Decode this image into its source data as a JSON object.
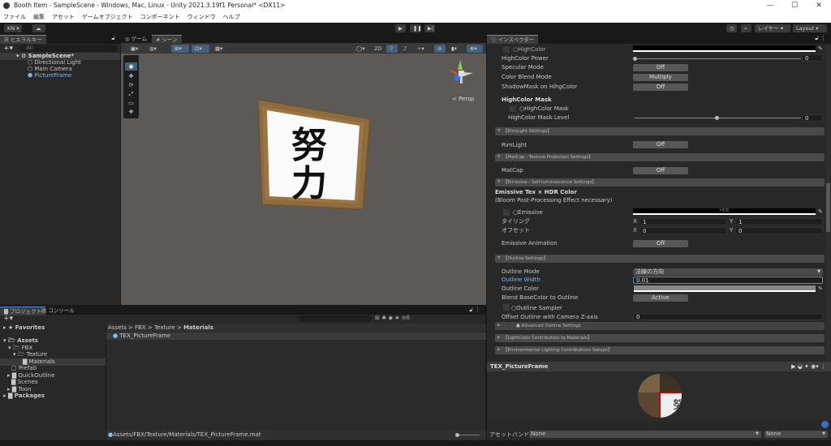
{
  "window": {
    "title": "Booth Item - SampleScene - Windows, Mac, Linux - Unity 2021.3.19f1 Personal* <DX11>",
    "minimize": "—",
    "maximize": "☐",
    "close": "✕"
  },
  "menu": [
    "ファイル",
    "編集",
    "アセット",
    "ゲームオブジェクト",
    "コンポーネント",
    "ウィンドウ",
    "ヘルプ"
  ],
  "toolbar": {
    "account": "KN ▾",
    "layers": "レイヤー",
    "layout": "Layout"
  },
  "hierarchy": {
    "tab": "ヒエラルキー",
    "search_placeholder": "All",
    "scene": "SampleScene*",
    "items": [
      "Directional Light",
      "Main Camera",
      "PictureFrame"
    ]
  },
  "scene_view": {
    "tabs": [
      "ゲーム",
      "シーン"
    ],
    "mode_2d": "2D",
    "persp": "Persp",
    "artwork_text": [
      "努",
      "力"
    ]
  },
  "inspector": {
    "tab": "インスペクター",
    "highcolor": "HighColor",
    "highcolor_power": {
      "label": "HighColor Power",
      "value": "0"
    },
    "specular_mode": {
      "label": "Specular Mode",
      "value": "Off"
    },
    "color_blend_mode": {
      "label": "Color Blend Mode",
      "value": "Multiply"
    },
    "shadowmask": {
      "label": "ShadowMask on HihgColor",
      "value": "Off"
    },
    "highcolor_mask_heading": "HighColor Mask",
    "highcolor_mask": "HighColor Mask",
    "highcolor_mask_level": {
      "label": "HighColor Mask Level",
      "value": "0"
    },
    "rimlight_header": "【RimLight Settings】",
    "rimlight": {
      "label": "RimLight",
      "value": "Off"
    },
    "matcap_header": "【MatCap : Texture Projection Settings】",
    "matcap": {
      "label": "MatCap",
      "value": "Off"
    },
    "emissive_header": "【Emissive : Self-luminescence Settings】",
    "emissive_title": "Emissive Tex × HDR Color",
    "emissive_note": "(Bloom Post-Processing Effect necessary)",
    "emissive": {
      "label": "Emissive",
      "hdr": "HDR"
    },
    "tiling": {
      "label": "タイリング",
      "x": "1",
      "y": "1"
    },
    "offset": {
      "label": "オフセット",
      "x": "0",
      "y": "0"
    },
    "axis_x": "X",
    "axis_y": "Y",
    "emissive_animation": {
      "label": "Emissive Animation",
      "value": "Off"
    },
    "outline_header": "【Outline Settings】",
    "outline_mode": {
      "label": "Outline Mode",
      "value": "法線の方向"
    },
    "outline_width": {
      "label": "Outline Width",
      "value": "0.01"
    },
    "outline_color": {
      "label": "Outline Color"
    },
    "blend_basecolor": {
      "label": "Blend BaseColor to Outline",
      "value": "Active"
    },
    "outline_sampler": "Outline Sampler",
    "offset_z": {
      "label": "Offset Outline with Camera Z-axis",
      "value": "0"
    },
    "advanced_outline": "● Advanced Outline Settings",
    "lightcolor_header": "【LightColor Contribution to Materials】",
    "environmental_header": "【Environmental Lighting Contributions Setups】",
    "preview_title": "TEX_PictureFrame",
    "asset_bundle": {
      "label": "アセットバンドル",
      "name": "None",
      "variant": "None"
    }
  },
  "project": {
    "tabs": [
      "プロジェクト",
      "コンソール"
    ],
    "favorites": "Favorites",
    "tree": [
      "Assets",
      "FBX",
      "Texture",
      "Materials",
      "Prefab",
      "QuickOutline",
      "Scenes",
      "Toon",
      "Packages"
    ],
    "breadcrumb": [
      "Assets",
      "FBX",
      "Texture",
      "Materials"
    ],
    "sep": ">",
    "asset": "TEX_PictureFrame",
    "path": "Assets/FBX/Texture/Materials/TEX_PictureFrame.mat",
    "hidden_count": "6"
  },
  "colors": {
    "accent": "#4d8fd8",
    "selected_text": "#7cb7ff"
  }
}
